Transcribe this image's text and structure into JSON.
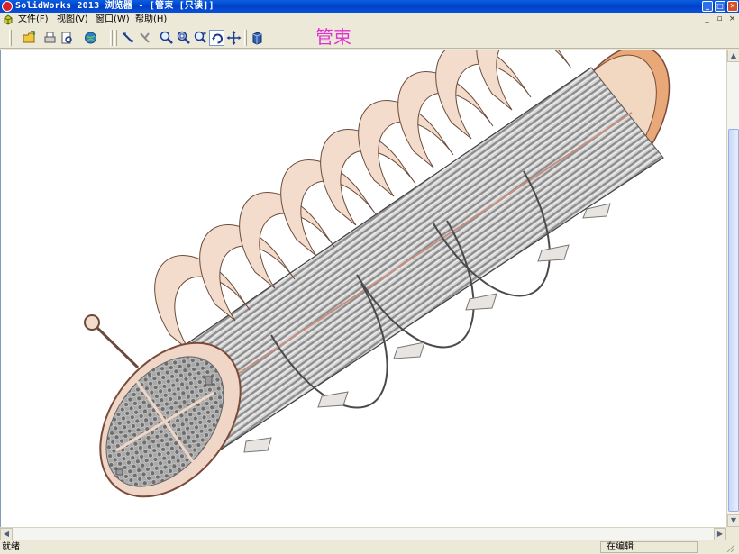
{
  "window": {
    "title": "SolidWorks 2013 浏览器 - [管束 [只读]]",
    "min": "_",
    "max": "□",
    "close": "✕"
  },
  "menu": {
    "items": [
      "文件(F)",
      "视图(V)",
      "窗口(W)",
      "帮助(H)"
    ],
    "mdi_min": "_",
    "mdi_restore": "▫",
    "mdi_close": "×"
  },
  "toolbar": {
    "buttons": [
      "open-icon",
      "print-icon",
      "print-preview-icon",
      "web-icon",
      "measure-icon",
      "hide-icon",
      "zoom-fit-icon",
      "zoom-area-icon",
      "zoom-in-out-icon",
      "rotate-icon",
      "pan-icon",
      "view-orientation-icon"
    ]
  },
  "document": {
    "label": "管束"
  },
  "status": {
    "left": "就绪",
    "right": "在编辑"
  },
  "colors": {
    "title_bar": "#0040c8",
    "doc_label": "#e030d0",
    "baffle": "#f3dccb",
    "tube": "#b7b7b7",
    "tubesheet": "#f0d6c6"
  }
}
